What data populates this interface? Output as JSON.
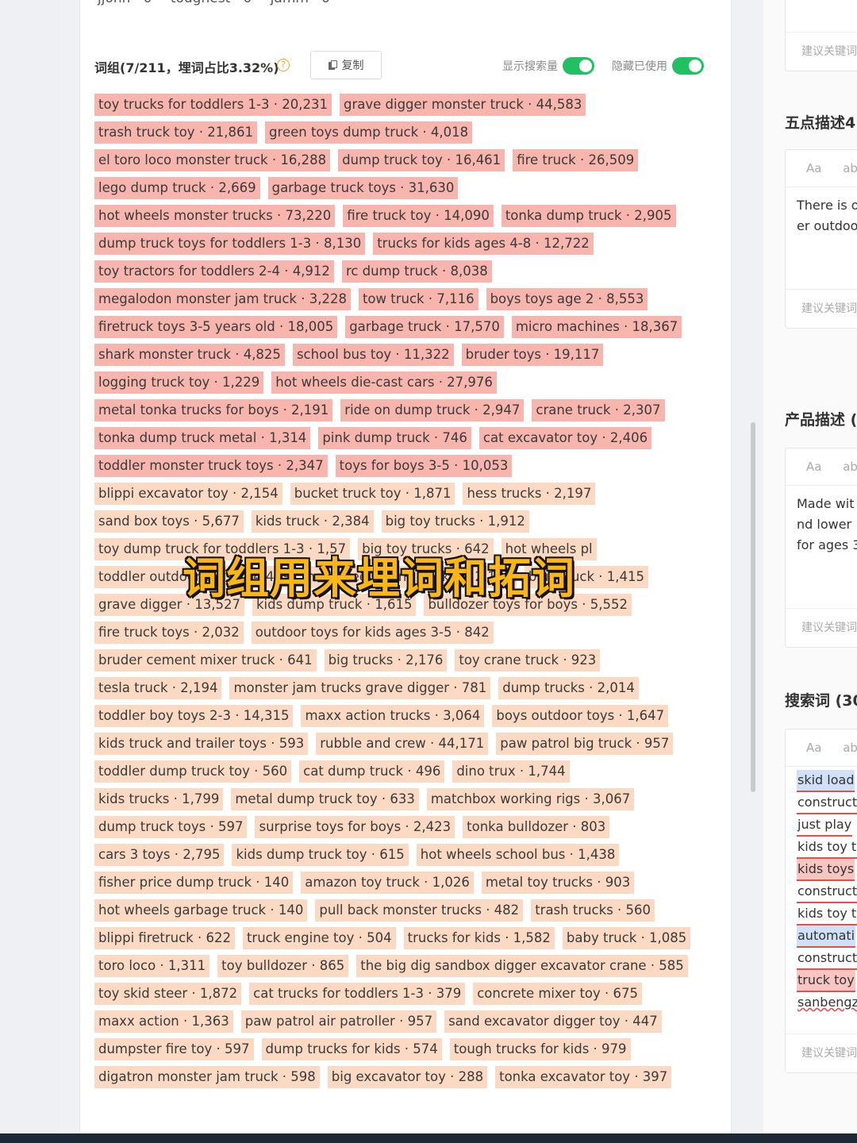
{
  "top_row": [
    "jjohn · 0",
    "toughest · 0",
    "jamm · 0"
  ],
  "header": {
    "title": "词组(7/211，埋词占比3.32%)",
    "help": "?",
    "copy_label": "复制",
    "toggle_search_volume": "显示搜索量",
    "toggle_hide_used": "隐藏已使用"
  },
  "chips": [
    {
      "text": "toy trucks for toddlers 1-3 · 20,231",
      "used": true
    },
    {
      "text": "grave digger monster truck · 44,583",
      "used": true
    },
    {
      "text": "trash truck toy · 21,861",
      "used": true
    },
    {
      "text": "green toys dump truck · 4,018",
      "used": true
    },
    {
      "text": "el toro loco monster truck · 16,288",
      "used": true
    },
    {
      "text": "dump truck toy · 16,461",
      "used": true
    },
    {
      "text": "fire truck · 26,509",
      "used": true
    },
    {
      "text": "lego dump truck · 2,669",
      "used": true
    },
    {
      "text": "garbage truck toys · 31,630",
      "used": true
    },
    {
      "text": "hot wheels monster trucks · 73,220",
      "used": true
    },
    {
      "text": "fire truck toy · 14,090",
      "used": true
    },
    {
      "text": "tonka dump truck · 2,905",
      "used": true
    },
    {
      "text": "dump truck toys for toddlers 1-3 · 8,130",
      "used": true
    },
    {
      "text": "trucks for kids ages 4-8 · 12,722",
      "used": true
    },
    {
      "text": "toy tractors for toddlers 2-4 · 4,912",
      "used": true
    },
    {
      "text": "rc dump truck · 8,038",
      "used": true
    },
    {
      "text": "megalodon monster jam truck · 3,228",
      "used": true
    },
    {
      "text": "tow truck · 7,116",
      "used": true
    },
    {
      "text": "boys toys age 2 · 8,553",
      "used": true
    },
    {
      "text": "firetruck toys 3-5 years old · 18,005",
      "used": true
    },
    {
      "text": "garbage truck · 17,570",
      "used": true
    },
    {
      "text": "micro machines · 18,367",
      "used": true
    },
    {
      "text": "shark monster truck · 4,825",
      "used": true
    },
    {
      "text": "school bus toy · 11,322",
      "used": true
    },
    {
      "text": "bruder toys · 19,117",
      "used": true
    },
    {
      "text": "logging truck toy · 1,229",
      "used": true
    },
    {
      "text": "hot wheels die-cast cars · 27,976",
      "used": true
    },
    {
      "text": "metal tonka trucks for boys · 2,191",
      "used": true
    },
    {
      "text": "ride on dump truck · 2,947",
      "used": true
    },
    {
      "text": "crane truck · 2,307",
      "used": true
    },
    {
      "text": "tonka dump truck metal · 1,314",
      "used": true
    },
    {
      "text": "pink dump truck · 746",
      "used": true
    },
    {
      "text": "cat excavator toy · 2,406",
      "used": true
    },
    {
      "text": "toddler monster truck toys · 2,347",
      "used": true
    },
    {
      "text": "toys for boys 3-5 · 10,053",
      "used": true
    },
    {
      "text": "blippi excavator toy · 2,154",
      "used": false
    },
    {
      "text": "bucket truck toy · 1,871",
      "used": false
    },
    {
      "text": "hess trucks · 2,197",
      "used": false
    },
    {
      "text": "sand box toys · 5,677",
      "used": false
    },
    {
      "text": "kids truck · 2,384",
      "used": false
    },
    {
      "text": "big toy trucks · 1,912",
      "used": false
    },
    {
      "text": "toy dump truck for toddlers 1-3 · 1,57",
      "used": false
    },
    {
      "text": "big toy trucks · 642",
      "used": false
    },
    {
      "text": "hot wheels pl",
      "used": false
    },
    {
      "text": "toddler outdoor toys · 44,439",
      "used": false
    },
    {
      "text": "hot wheels bone shaker · 2,132",
      "used": false
    },
    {
      "text": "blue truck · 1,415",
      "used": false
    },
    {
      "text": "grave digger · 13,527",
      "used": false
    },
    {
      "text": "kids dump truck · 1,615",
      "used": false
    },
    {
      "text": "bulldozer toys for boys · 5,552",
      "used": false
    },
    {
      "text": "fire truck toys · 2,032",
      "used": false
    },
    {
      "text": "outdoor toys for kids ages 3-5 · 842",
      "used": false
    },
    {
      "text": "bruder cement mixer truck · 641",
      "used": false
    },
    {
      "text": "big trucks · 2,176",
      "used": false
    },
    {
      "text": "toy crane truck · 923",
      "used": false
    },
    {
      "text": "tesla truck · 2,194",
      "used": false
    },
    {
      "text": "monster jam trucks grave digger · 781",
      "used": false
    },
    {
      "text": "dump trucks · 2,014",
      "used": false
    },
    {
      "text": "toddler boy toys 2-3 · 14,315",
      "used": false
    },
    {
      "text": "maxx action trucks · 3,064",
      "used": false
    },
    {
      "text": "boys outdoor toys · 1,647",
      "used": false
    },
    {
      "text": "kids truck and trailer toys · 593",
      "used": false
    },
    {
      "text": "rubble and crew · 44,171",
      "used": false
    },
    {
      "text": "paw patrol big truck · 957",
      "used": false
    },
    {
      "text": "toddler dump truck toy · 560",
      "used": false
    },
    {
      "text": "cat dump truck · 496",
      "used": false
    },
    {
      "text": "dino trux · 1,744",
      "used": false
    },
    {
      "text": "kids trucks · 1,799",
      "used": false
    },
    {
      "text": "metal dump truck toy · 633",
      "used": false
    },
    {
      "text": "matchbox working rigs · 3,067",
      "used": false
    },
    {
      "text": "dump truck toys · 597",
      "used": false
    },
    {
      "text": "surprise toys for boys · 2,423",
      "used": false
    },
    {
      "text": "tonka bulldozer · 803",
      "used": false
    },
    {
      "text": "cars 3 toys · 2,795",
      "used": false
    },
    {
      "text": "kids dump truck toy · 615",
      "used": false
    },
    {
      "text": "hot wheels school bus · 1,438",
      "used": false
    },
    {
      "text": "fisher price dump truck · 140",
      "used": false
    },
    {
      "text": "amazon toy truck · 1,026",
      "used": false
    },
    {
      "text": "metal toy trucks · 903",
      "used": false
    },
    {
      "text": "hot wheels garbage truck · 140",
      "used": false
    },
    {
      "text": "pull back monster trucks · 482",
      "used": false
    },
    {
      "text": "trash trucks · 560",
      "used": false
    },
    {
      "text": "blippi firetruck · 622",
      "used": false
    },
    {
      "text": "truck engine toy · 504",
      "used": false
    },
    {
      "text": "trucks for kids · 1,582",
      "used": false
    },
    {
      "text": "baby truck · 1,085",
      "used": false
    },
    {
      "text": "toro loco · 1,311",
      "used": false
    },
    {
      "text": "toy bulldozer · 865",
      "used": false
    },
    {
      "text": "the big dig sandbox digger excavator crane · 585",
      "used": false
    },
    {
      "text": "toy skid steer · 1,872",
      "used": false
    },
    {
      "text": "cat trucks for toddlers 1-3 · 379",
      "used": false
    },
    {
      "text": "concrete mixer toy · 675",
      "used": false
    },
    {
      "text": "maxx action · 1,363",
      "used": false
    },
    {
      "text": "paw patrol air patroller · 957",
      "used": false
    },
    {
      "text": "sand excavator digger toy · 447",
      "used": false
    },
    {
      "text": "dumpster fire toy · 597",
      "used": false
    },
    {
      "text": "dump trucks for kids · 574",
      "used": false
    },
    {
      "text": "tough trucks for kids · 979",
      "used": false
    },
    {
      "text": "digatron monster jam truck · 598",
      "used": false
    },
    {
      "text": "big excavator toy · 288",
      "used": false
    },
    {
      "text": "tonka excavator toy · 397",
      "used": false
    }
  ],
  "overlay_caption": "词组用来埋词和拓词",
  "right_panel": {
    "top_card_footer": "建议关键词",
    "five_point_title": "五点描述4",
    "product_desc_title": "产品描述 (",
    "search_terms_title": "搜索词 (30",
    "toolbar_aa": "Aa",
    "toolbar_ab": "ab",
    "footer_label": "建议关键词",
    "five_point_lines": [
      "There is o",
      "er outdoo"
    ],
    "product_desc_lines": [
      "Made wit",
      "nd lower",
      "for ages 3"
    ],
    "search_terms": [
      "skid load",
      "construct",
      "just play",
      "kids toy t",
      "kids toys",
      "construct",
      "kids toy t",
      "automati",
      "construct",
      "truck toy",
      "sanbengz"
    ]
  }
}
